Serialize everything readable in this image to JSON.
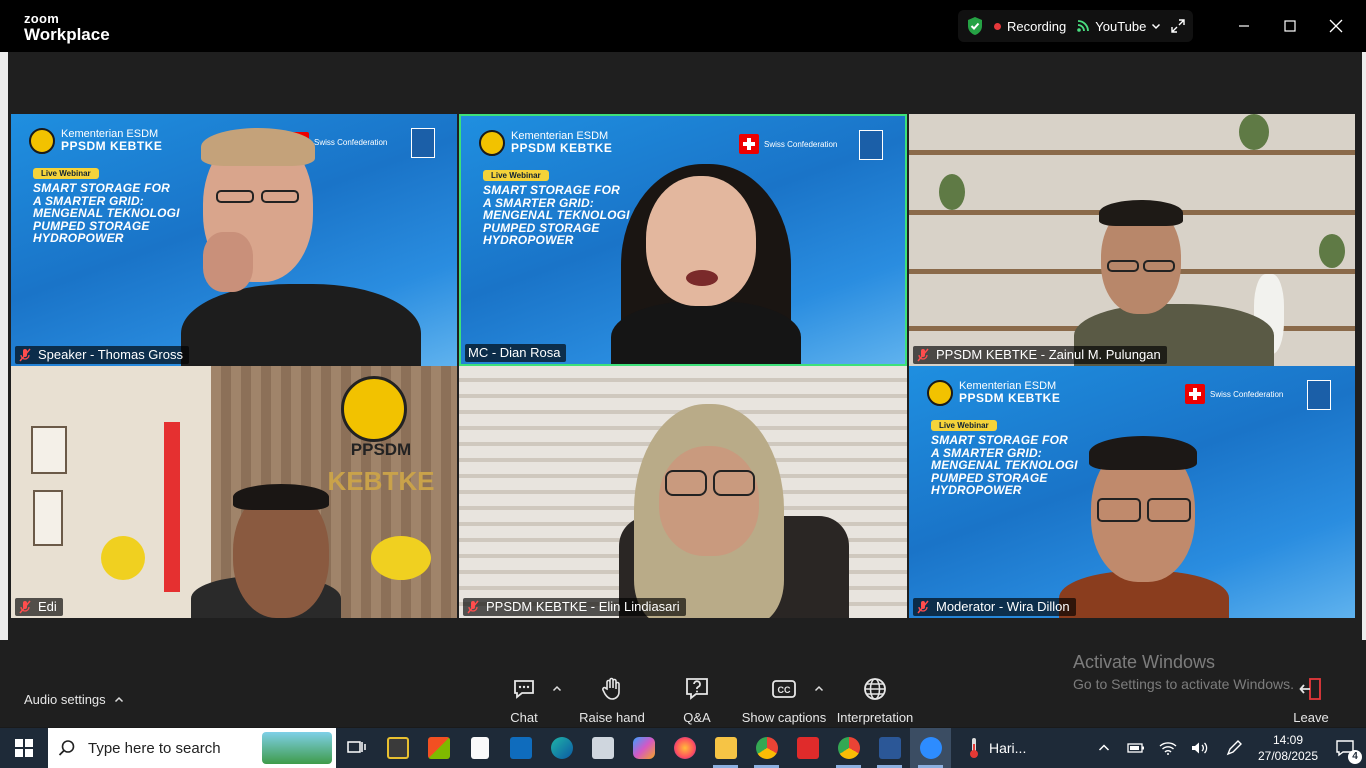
{
  "app": {
    "logo_top": "zoom",
    "logo_bottom": "Workplace"
  },
  "header": {
    "recording_label": "Recording",
    "stream_label": "YouTube"
  },
  "webinar": {
    "org_line1": "Kementerian ESDM",
    "org_line2": "PPSDM KEBTKE",
    "partner": "Swiss Confederation",
    "badge": "Live Webinar",
    "headline_lines": [
      "SMART STORAGE FOR",
      "A SMARTER GRID:",
      "MENGENAL TEKNOLOGI",
      "PUMPED STORAGE",
      "HYDROPOWER"
    ]
  },
  "tiles": [
    {
      "name": "Speaker - Thomas Gross"
    },
    {
      "name": "MC - Dian Rosa"
    },
    {
      "name": "PPSDM KEBTKE - Zainul M. Pulungan"
    },
    {
      "name": "Edi"
    },
    {
      "name": "PPSDM KEBTKE - Elin Lindiasari"
    },
    {
      "name": "Moderator - Wira Dillon"
    }
  ],
  "wall_sign": {
    "line1": "PPSDM",
    "line2": "KEBTKE"
  },
  "toolbar": {
    "audio_settings": "Audio settings",
    "chat": "Chat",
    "raise_hand": "Raise hand",
    "qa": "Q&A",
    "show_captions": "Show captions",
    "interpretation": "Interpretation",
    "leave": "Leave"
  },
  "watermark": {
    "line1": "Activate Windows",
    "line2": "Go to Settings to activate Windows."
  },
  "taskbar": {
    "search_placeholder": "Type here to search",
    "weather_text": "Hari...",
    "time": "14:09",
    "date": "27/08/2025",
    "notification_count": "4"
  },
  "colors": {
    "active_speaker_border": "#3ee07a",
    "webinar_blue": "#1f80d8",
    "rec_red": "#e5383b"
  }
}
